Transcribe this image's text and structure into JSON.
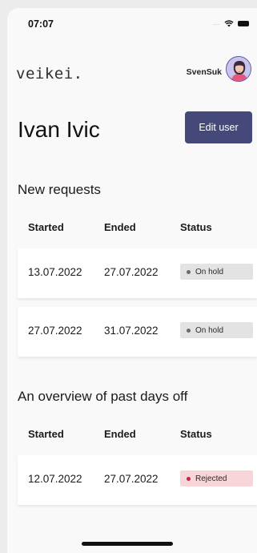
{
  "status_bar": {
    "time": "07:07",
    "signal": "....."
  },
  "header": {
    "logo": "veikei.",
    "username": "SvenSuk"
  },
  "page": {
    "title": "Ivan Ivic",
    "edit_button_label": "Edit user"
  },
  "new_requests": {
    "title": "New requests",
    "columns": [
      "Started",
      "Ended",
      "Status"
    ],
    "rows": [
      {
        "started": "13.07.2022",
        "ended": "27.07.2022",
        "status": "On hold"
      },
      {
        "started": "27.07.2022",
        "ended": "31.07.2022",
        "status": "On hold"
      }
    ]
  },
  "past_days_off": {
    "title": "An overview of past days off",
    "columns": [
      "Started",
      "Ended",
      "Status"
    ],
    "rows": [
      {
        "started": "12.07.2022",
        "ended": "27.07.2022",
        "status": "Rejected"
      }
    ]
  },
  "colors": {
    "accent": "#44497a",
    "on_hold_badge_bg": "#e3e3e3",
    "on_hold_dot": "#6b6b6b",
    "rejected_badge_bg": "#f8d5d9",
    "rejected_dot": "#d81b3c"
  },
  "icons": [
    "wifi-icon",
    "battery-icon",
    "avatar-icon"
  ]
}
